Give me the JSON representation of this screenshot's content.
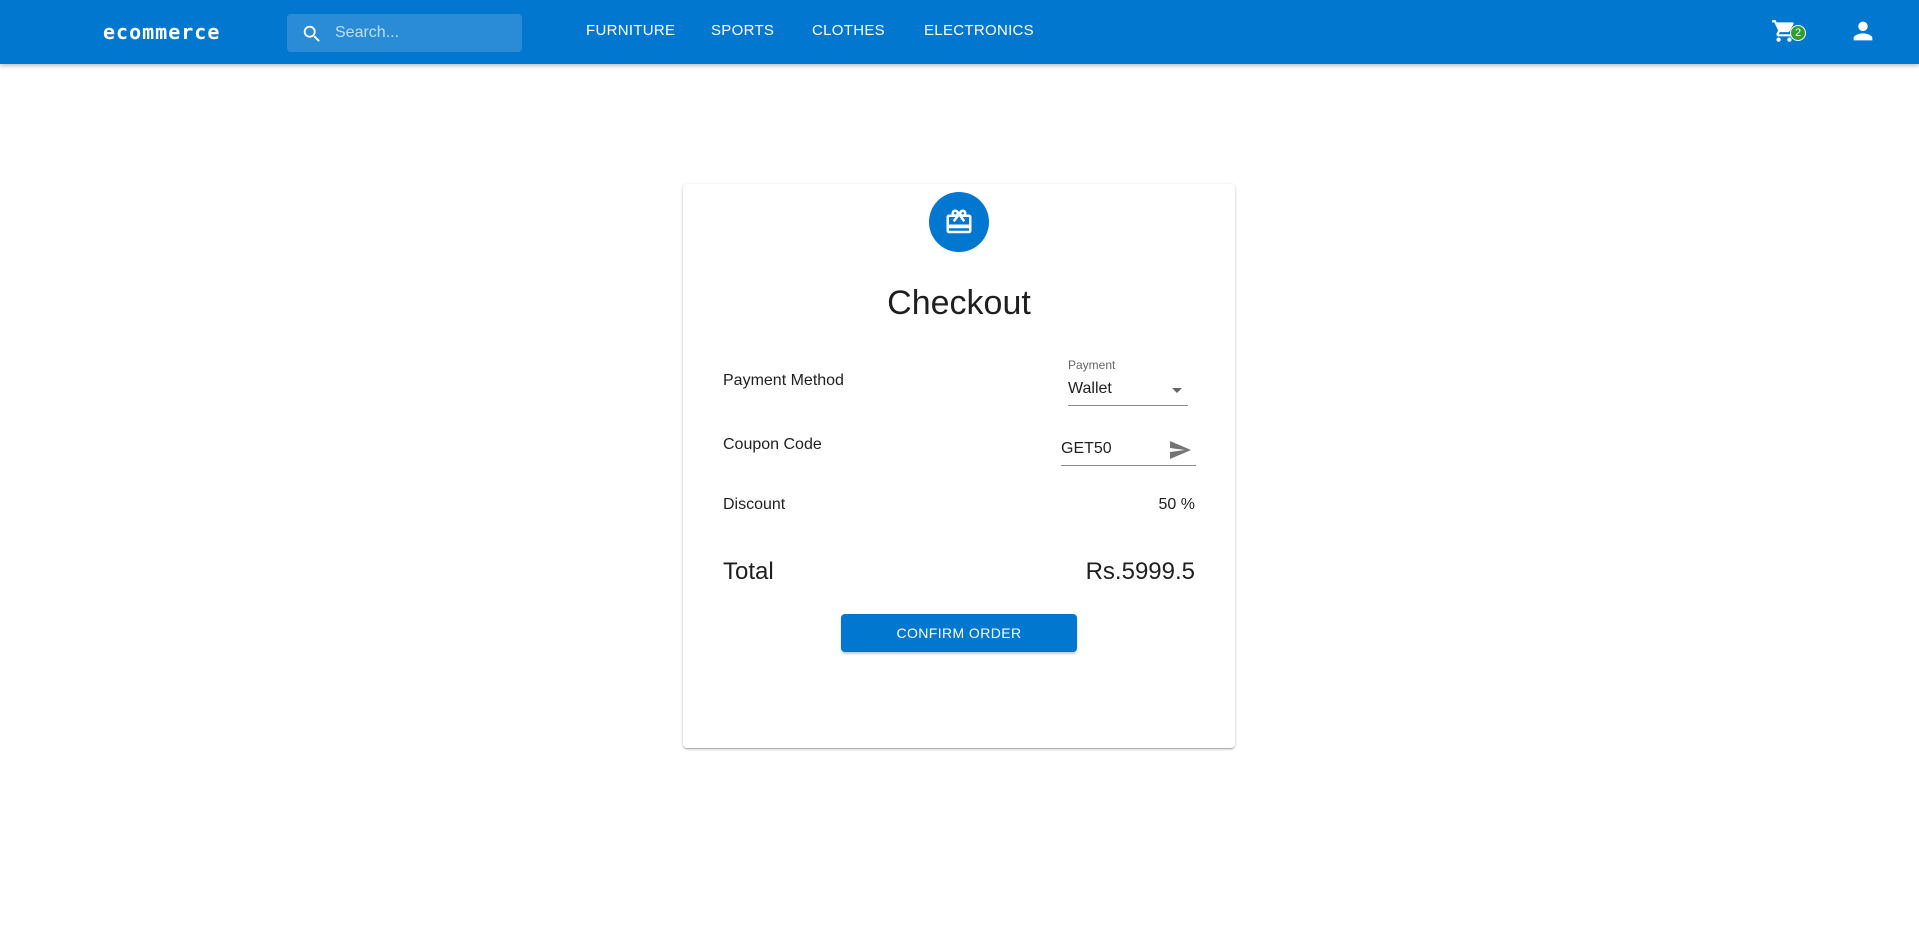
{
  "header": {
    "brand": "ecommerce",
    "search_placeholder": "Search...",
    "nav": [
      "FURNITURE",
      "SPORTS",
      "CLOTHES",
      "ELECTRONICS"
    ],
    "cart_count": "2",
    "cart_icon": "cart-icon",
    "account_icon": "account-icon"
  },
  "checkout": {
    "icon": "redeem-icon",
    "title": "Checkout",
    "payment_method_label": "Payment Method",
    "payment_select_label": "Payment",
    "payment_value": "Wallet",
    "coupon_label": "Coupon Code",
    "coupon_value": "GET50",
    "discount_label": "Discount",
    "discount_value": "50 %",
    "total_label": "Total",
    "total_value": "Rs.5999.5",
    "confirm_label": "CONFIRM ORDER"
  },
  "colors": {
    "primary": "#0277cf",
    "badge": "#2e9e2e"
  }
}
